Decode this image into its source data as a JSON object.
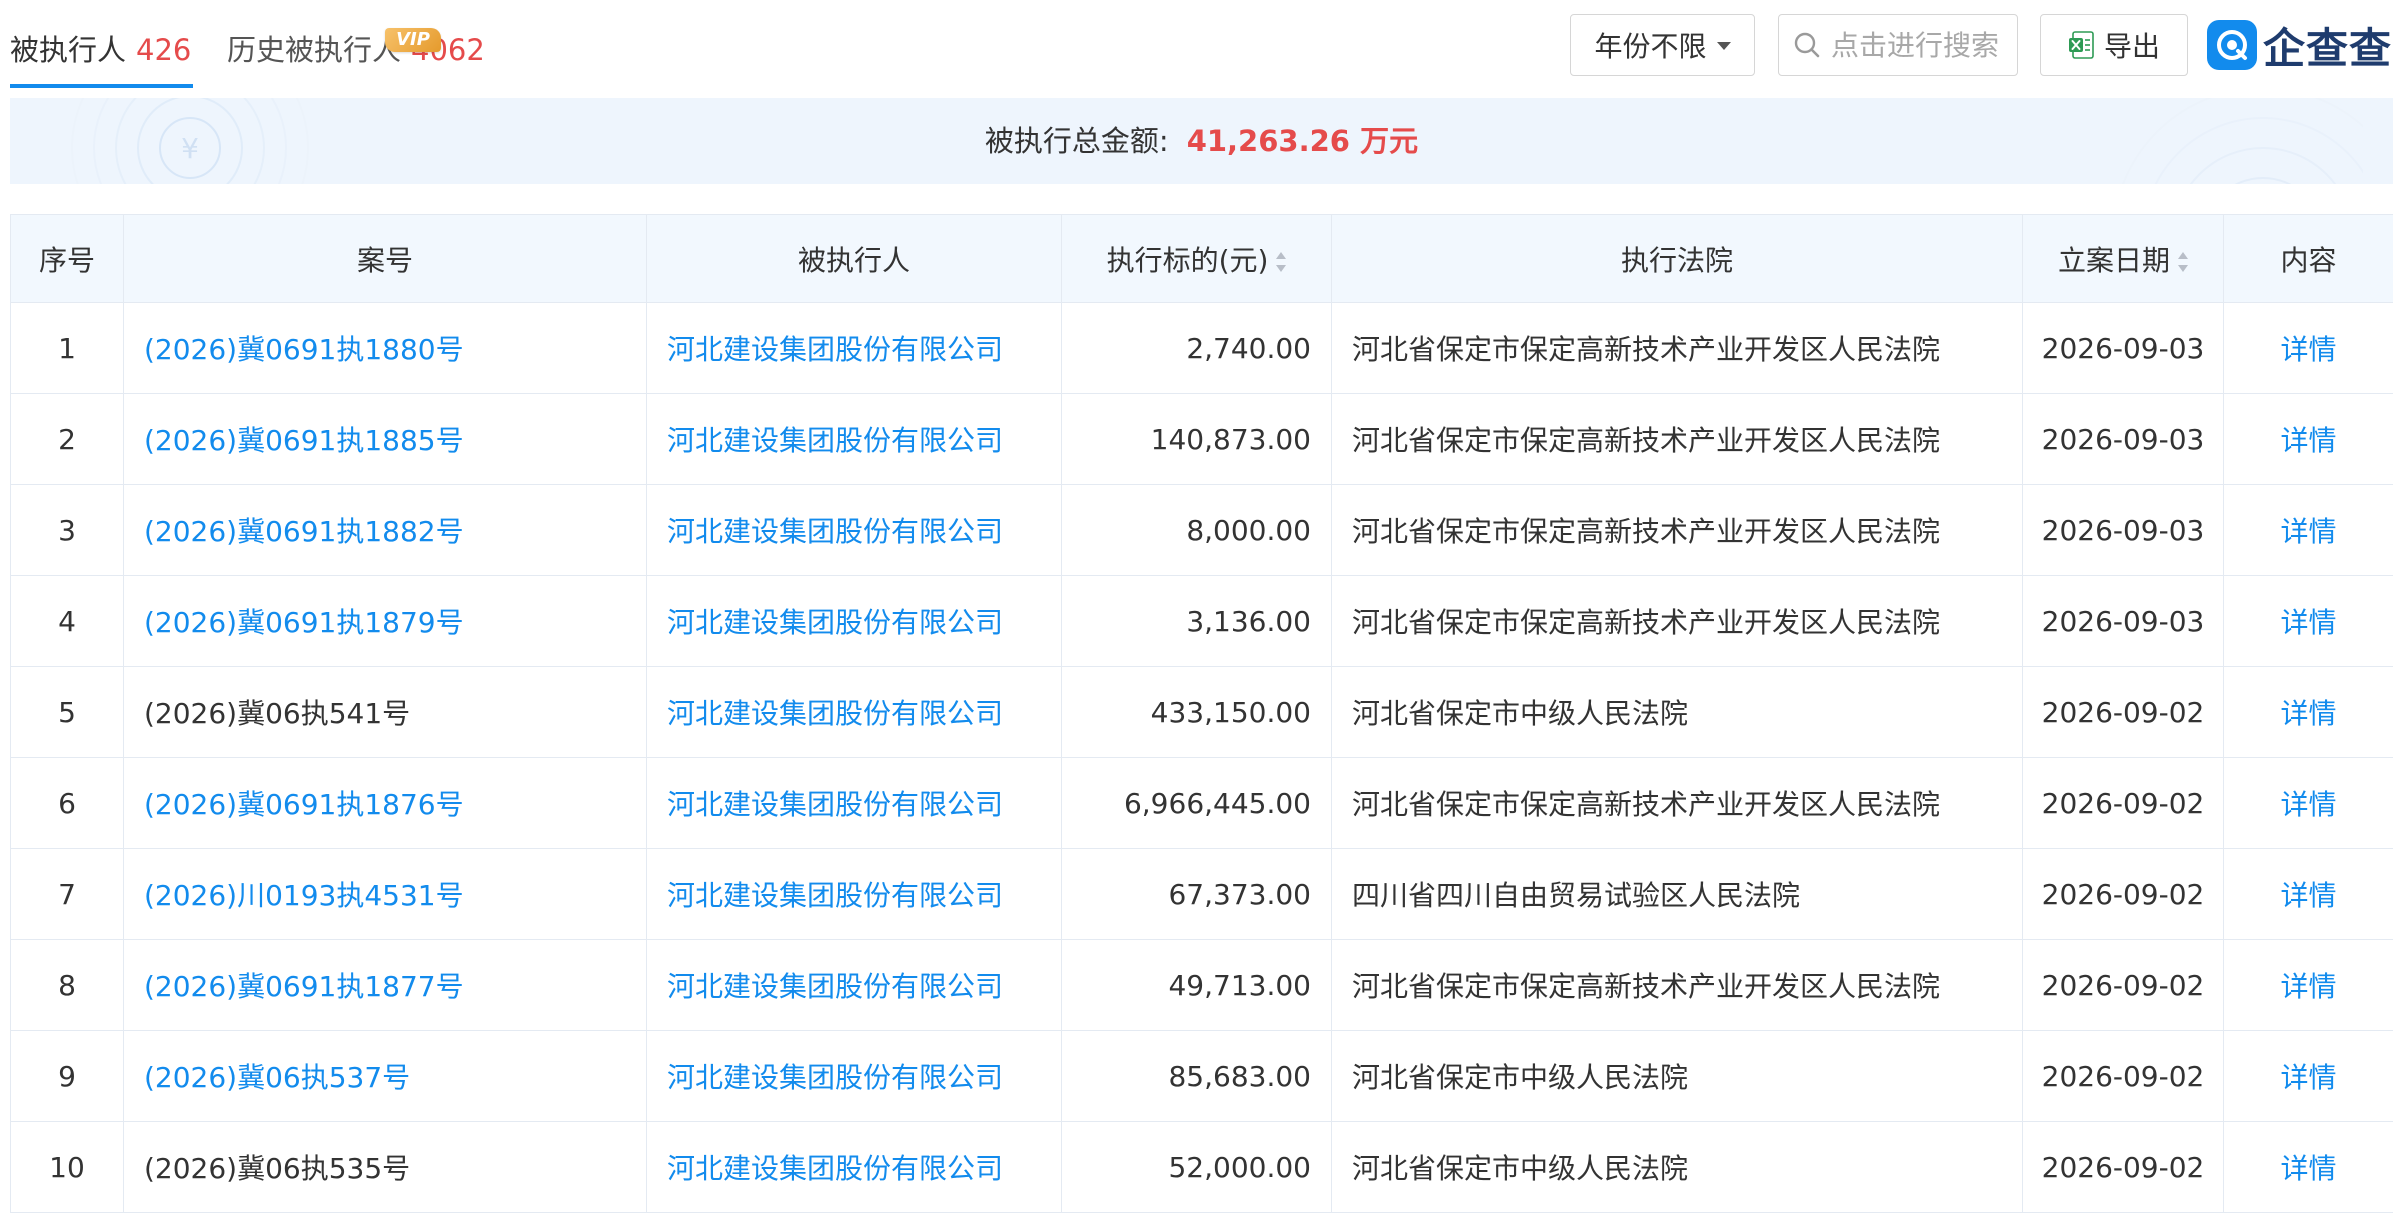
{
  "tabs": {
    "active": {
      "label": "被执行人",
      "count": "426"
    },
    "history": {
      "label": "历史被执行人",
      "count": "4062",
      "badge": "VIP"
    }
  },
  "toolbar": {
    "year_filter": "年份不限",
    "search_placeholder": "点击进行搜索",
    "export_label": "导出",
    "brand": "企查查"
  },
  "summary": {
    "label": "被执行总金额:",
    "amount": "41,263.26 万元"
  },
  "table": {
    "columns": [
      "序号",
      "案号",
      "被执行人",
      "执行标的(元)",
      "执行法院",
      "立案日期",
      "内容"
    ],
    "rows": [
      {
        "idx": "1",
        "case_no": "(2026)冀0691执1880号",
        "case_link": true,
        "party": "河北建设集团股份有限公司",
        "amount": "2,740.00",
        "court": "河北省保定市保定高新技术产业开发区人民法院",
        "date": "2026-09-03",
        "detail": "详情"
      },
      {
        "idx": "2",
        "case_no": "(2026)冀0691执1885号",
        "case_link": true,
        "party": "河北建设集团股份有限公司",
        "amount": "140,873.00",
        "court": "河北省保定市保定高新技术产业开发区人民法院",
        "date": "2026-09-03",
        "detail": "详情"
      },
      {
        "idx": "3",
        "case_no": "(2026)冀0691执1882号",
        "case_link": true,
        "party": "河北建设集团股份有限公司",
        "amount": "8,000.00",
        "court": "河北省保定市保定高新技术产业开发区人民法院",
        "date": "2026-09-03",
        "detail": "详情"
      },
      {
        "idx": "4",
        "case_no": "(2026)冀0691执1879号",
        "case_link": true,
        "party": "河北建设集团股份有限公司",
        "amount": "3,136.00",
        "court": "河北省保定市保定高新技术产业开发区人民法院",
        "date": "2026-09-03",
        "detail": "详情"
      },
      {
        "idx": "5",
        "case_no": "(2026)冀06执541号",
        "case_link": false,
        "party": "河北建设集团股份有限公司",
        "amount": "433,150.00",
        "court": "河北省保定市中级人民法院",
        "date": "2026-09-02",
        "detail": "详情"
      },
      {
        "idx": "6",
        "case_no": "(2026)冀0691执1876号",
        "case_link": true,
        "party": "河北建设集团股份有限公司",
        "amount": "6,966,445.00",
        "court": "河北省保定市保定高新技术产业开发区人民法院",
        "date": "2026-09-02",
        "detail": "详情"
      },
      {
        "idx": "7",
        "case_no": "(2026)川0193执4531号",
        "case_link": true,
        "party": "河北建设集团股份有限公司",
        "amount": "67,373.00",
        "court": "四川省四川自由贸易试验区人民法院",
        "date": "2026-09-02",
        "detail": "详情"
      },
      {
        "idx": "8",
        "case_no": "(2026)冀0691执1877号",
        "case_link": true,
        "party": "河北建设集团股份有限公司",
        "amount": "49,713.00",
        "court": "河北省保定市保定高新技术产业开发区人民法院",
        "date": "2026-09-02",
        "detail": "详情"
      },
      {
        "idx": "9",
        "case_no": "(2026)冀06执537号",
        "case_link": true,
        "party": "河北建设集团股份有限公司",
        "amount": "85,683.00",
        "court": "河北省保定市中级人民法院",
        "date": "2026-09-02",
        "detail": "详情"
      },
      {
        "idx": "10",
        "case_no": "(2026)冀06执535号",
        "case_link": false,
        "party": "河北建设集团股份有限公司",
        "amount": "52,000.00",
        "court": "河北省保定市中级人民法院",
        "date": "2026-09-02",
        "detail": "详情"
      }
    ]
  },
  "colors": {
    "link": "#128bed",
    "accent_red": "#e54b4b",
    "header_bg": "#f2f8fe",
    "banner_bg": "#eef5fd"
  }
}
